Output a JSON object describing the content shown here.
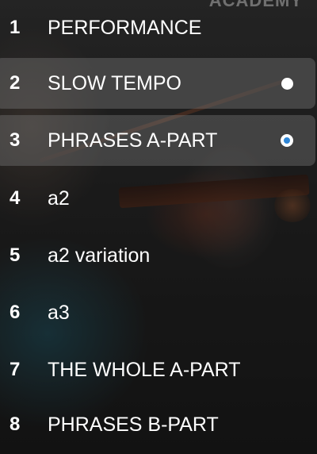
{
  "brand": "ACADEMY",
  "chapters": [
    {
      "number": "1",
      "title": "PERFORMANCE",
      "selected": false
    },
    {
      "number": "2",
      "title": "SLOW TEMPO",
      "selected": true,
      "indicator": "watched-dot-icon"
    },
    {
      "number": "3",
      "title": "PHRASES A-PART",
      "selected": true,
      "indicator": "playing-dot-icon"
    },
    {
      "number": "4",
      "title": "a2",
      "selected": false
    },
    {
      "number": "5",
      "title": "a2 variation",
      "selected": false
    },
    {
      "number": "6",
      "title": "a3",
      "selected": false
    },
    {
      "number": "7",
      "title": "THE WHOLE A-PART",
      "selected": false
    },
    {
      "number": "8",
      "title": "PHRASES B-PART",
      "selected": false
    }
  ],
  "colors": {
    "highlight": "#6f6f6f",
    "playing_dot": "#2f86d6",
    "text": "#ffffff"
  }
}
